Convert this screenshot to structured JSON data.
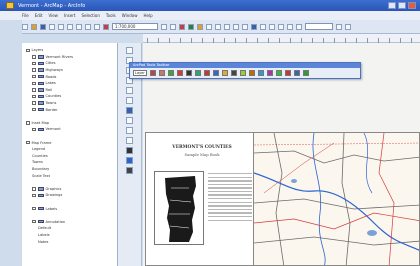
{
  "window": {
    "title": "Vermont - ArcMap - ArcInfo",
    "buttons": [
      "minimize-icon",
      "maximize-icon",
      "close-icon"
    ]
  },
  "menubar": {
    "items": [
      "File",
      "Edit",
      "View",
      "Insert",
      "Selection",
      "Tools",
      "Window",
      "Help"
    ]
  },
  "toolbar": {
    "scale_value": "1:700,000",
    "icons": [
      "new-icon",
      "open-icon",
      "save-icon",
      "print-icon",
      "cut-icon",
      "copy-icon",
      "paste-icon",
      "undo-icon",
      "redo-icon",
      "add-data-icon",
      "zoom-in-icon",
      "zoom-out-icon",
      "pan-icon",
      "full-extent-icon",
      "identify-icon",
      "find-icon",
      "measure-icon"
    ]
  },
  "floating_toolbar": {
    "title": "ArcPad Tools Toolbar",
    "dropdown_label": "Layer",
    "icon_count": 18,
    "colors": [
      "#b44",
      "#c76",
      "#3a3",
      "#d33",
      "#333",
      "#2a7",
      "#c33",
      "#36c",
      "#da3",
      "#444",
      "#9c3",
      "#c60",
      "#39c",
      "#a3a",
      "#3b3",
      "#c33",
      "#36a",
      "#393"
    ]
  },
  "toc": {
    "items": [
      {
        "label": "Layers",
        "level": 0,
        "type": "group"
      },
      {
        "label": "Vermont Rivers",
        "level": 1,
        "type": "layer"
      },
      {
        "label": "Cities",
        "level": 1,
        "type": "layer"
      },
      {
        "label": "Highways",
        "level": 1,
        "type": "layer"
      },
      {
        "label": "Roads",
        "level": 1,
        "type": "layer"
      },
      {
        "label": "Lakes",
        "level": 1,
        "type": "layer"
      },
      {
        "label": "Rail",
        "level": 1,
        "type": "layer"
      },
      {
        "label": "Counties",
        "level": 1,
        "type": "layer"
      },
      {
        "label": "Towns",
        "level": 1,
        "type": "layer"
      },
      {
        "label": "Border",
        "level": 1,
        "type": "layer"
      },
      {
        "label": "",
        "level": 0,
        "type": "spacer"
      },
      {
        "label": "Inset Map",
        "level": 0,
        "type": "group"
      },
      {
        "label": "Vermont",
        "level": 1,
        "type": "layer"
      },
      {
        "label": "",
        "level": 0,
        "type": "spacer"
      },
      {
        "label": "Map Frame",
        "level": 0,
        "type": "group"
      },
      {
        "label": "Legend",
        "level": 1,
        "type": "text"
      },
      {
        "label": "Counties",
        "level": 1,
        "type": "text"
      },
      {
        "label": "Towns",
        "level": 1,
        "type": "text"
      },
      {
        "label": "Boundary",
        "level": 1,
        "type": "text"
      },
      {
        "label": "Scale Text",
        "level": 1,
        "type": "text"
      },
      {
        "label": "",
        "level": 0,
        "type": "spacer"
      },
      {
        "label": "Graphics",
        "level": 1,
        "type": "layer"
      },
      {
        "label": "Drawings",
        "level": 1,
        "type": "layer"
      },
      {
        "label": "",
        "level": 0,
        "type": "spacer"
      },
      {
        "label": "Labels",
        "level": 1,
        "type": "layer"
      },
      {
        "label": "",
        "level": 0,
        "type": "spacer"
      },
      {
        "label": "Annotation",
        "level": 1,
        "type": "layer"
      },
      {
        "label": "Default",
        "level": 2,
        "type": "text"
      },
      {
        "label": "Labels",
        "level": 2,
        "type": "text"
      },
      {
        "label": "Notes",
        "level": 2,
        "type": "text"
      }
    ]
  },
  "layout_page": {
    "title": "VERMONT'S COUNTIES",
    "subtitle": "Sample Map Book"
  },
  "colors": {
    "titlebar": "#2d5bbf",
    "ribbon_bg": "#dde6f2",
    "river": "#2b63d1",
    "road": "#d23c3c",
    "boundary": "#6b6b6b"
  }
}
